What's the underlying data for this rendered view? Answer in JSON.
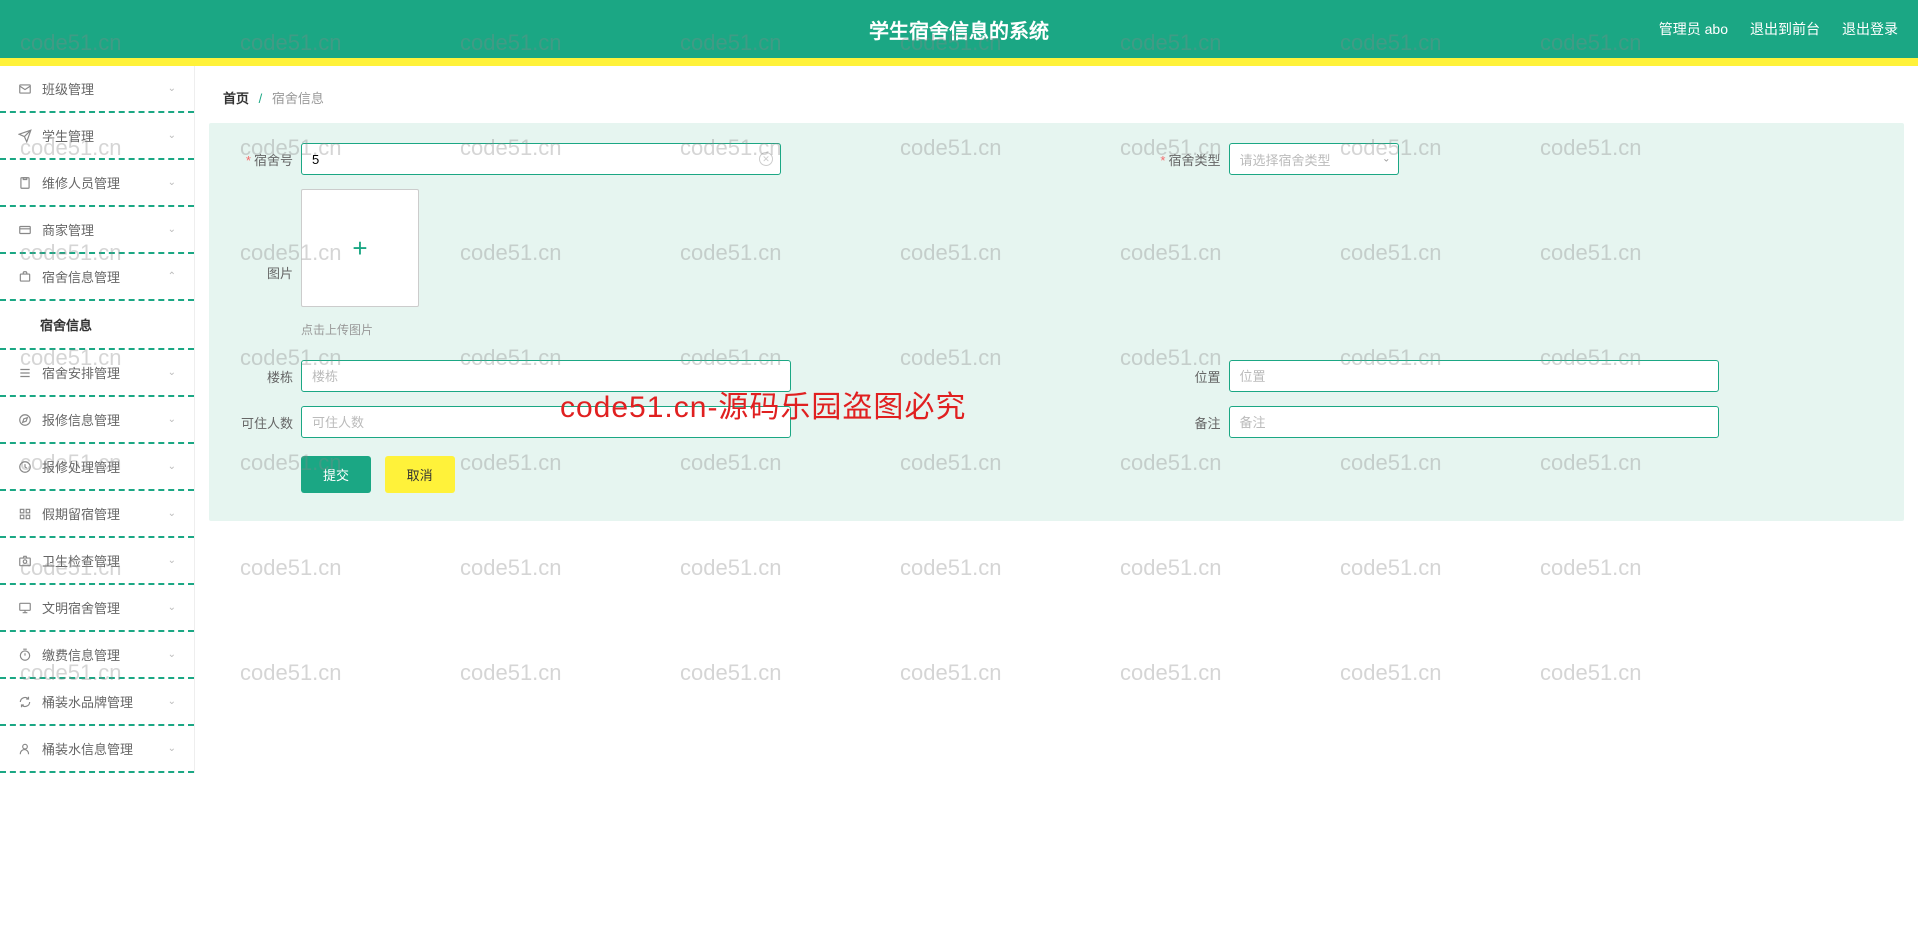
{
  "header": {
    "title": "学生宿舍信息的系统",
    "admin": "管理员 abo",
    "logout_front": "退出到前台",
    "logout": "退出登录"
  },
  "sidebar": {
    "items": [
      {
        "label": "班级管理",
        "icon": "mail"
      },
      {
        "label": "学生管理",
        "icon": "plane"
      },
      {
        "label": "维修人员管理",
        "icon": "clipboard"
      },
      {
        "label": "商家管理",
        "icon": "card"
      },
      {
        "label": "宿舍信息管理",
        "icon": "suitcase",
        "expanded": true
      },
      {
        "label": "宿舍安排管理",
        "icon": "list"
      },
      {
        "label": "报修信息管理",
        "icon": "compass"
      },
      {
        "label": "报修处理管理",
        "icon": "clock"
      },
      {
        "label": "假期留宿管理",
        "icon": "grid"
      },
      {
        "label": "卫生检查管理",
        "icon": "camera"
      },
      {
        "label": "文明宿舍管理",
        "icon": "monitor"
      },
      {
        "label": "缴费信息管理",
        "icon": "timer"
      },
      {
        "label": "桶装水品牌管理",
        "icon": "refresh"
      },
      {
        "label": "桶装水信息管理",
        "icon": "user"
      }
    ],
    "submenu": "宿舍信息"
  },
  "breadcrumb": {
    "home": "首页",
    "current": "宿舍信息"
  },
  "form": {
    "dorm_no_label": "宿舍号",
    "dorm_no_value": "5",
    "dorm_type_label": "宿舍类型",
    "dorm_type_placeholder": "请选择宿舍类型",
    "pic_label": "图片",
    "upload_hint": "点击上传图片",
    "building_label": "楼栋",
    "building_placeholder": "楼栋",
    "location_label": "位置",
    "location_placeholder": "位置",
    "capacity_label": "可住人数",
    "capacity_placeholder": "可住人数",
    "remark_label": "备注",
    "remark_placeholder": "备注",
    "submit": "提交",
    "cancel": "取消"
  },
  "watermarks": {
    "grey": "code51.cn",
    "red": "code51.cn-源码乐园盗图必究"
  }
}
